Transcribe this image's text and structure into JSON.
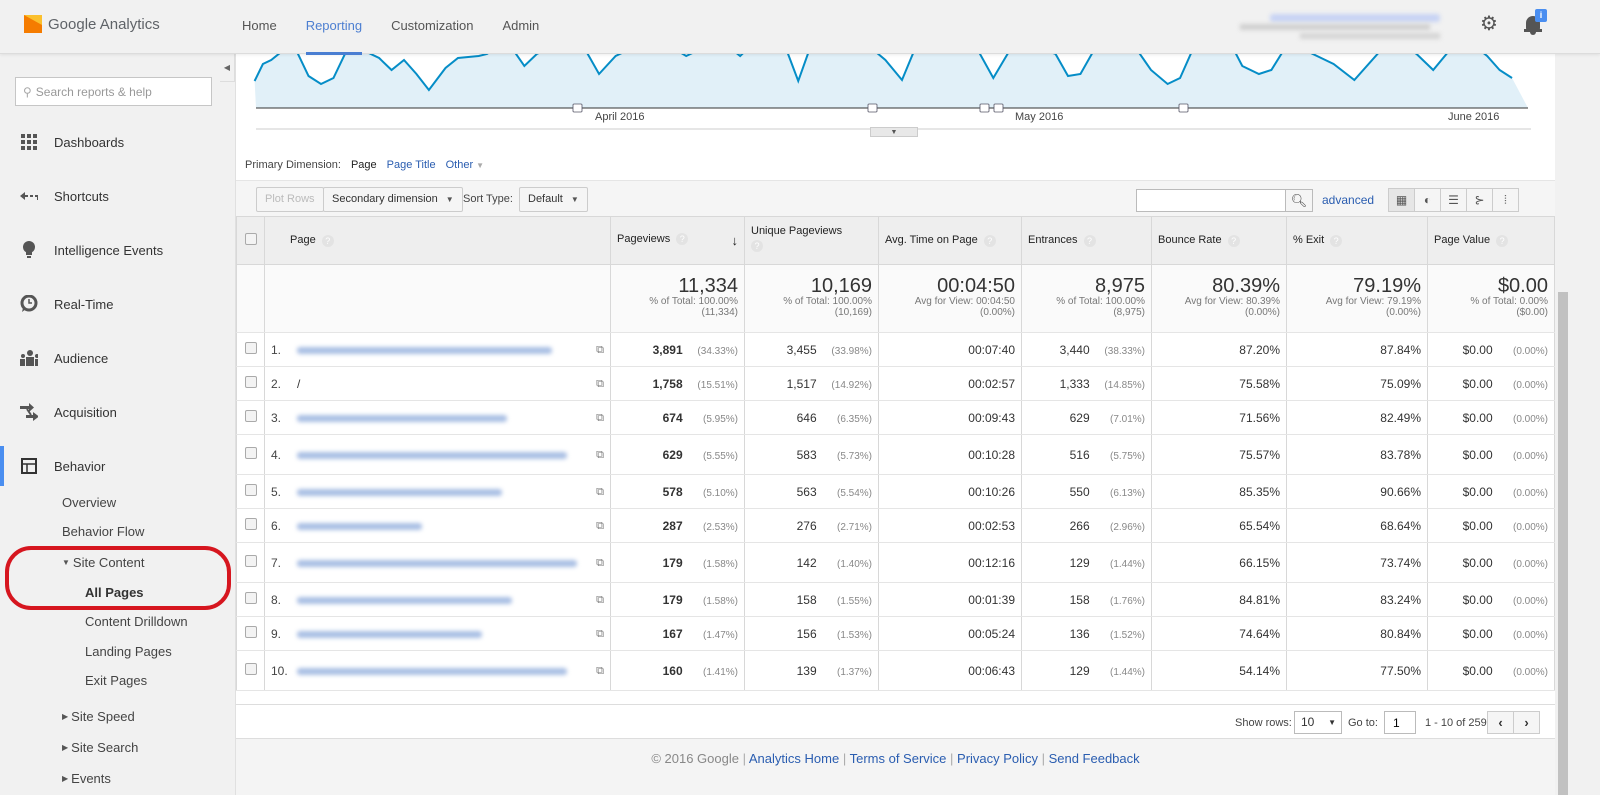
{
  "app": {
    "name_google": "Google",
    "name_product": "Analytics"
  },
  "nav": [
    {
      "label": "Home",
      "active": false
    },
    {
      "label": "Reporting",
      "active": true
    },
    {
      "label": "Customization",
      "active": false
    },
    {
      "label": "Admin",
      "active": false
    }
  ],
  "notifications": {
    "badge": "i"
  },
  "sidebar": {
    "search_placeholder": "Search reports & help",
    "items": [
      {
        "label": "Dashboards",
        "icon": "dashboards-icon"
      },
      {
        "label": "Shortcuts",
        "icon": "shortcuts-icon"
      },
      {
        "label": "Intelligence Events",
        "icon": "lightbulb-icon"
      },
      {
        "label": "Real-Time",
        "icon": "clock-icon"
      },
      {
        "label": "Audience",
        "icon": "people-icon"
      },
      {
        "label": "Acquisition",
        "icon": "arrows-icon"
      },
      {
        "label": "Behavior",
        "icon": "layout-icon"
      }
    ],
    "behavior_sub": {
      "overview": "Overview",
      "flow": "Behavior Flow",
      "site_content": "Site Content",
      "all_pages": "All Pages",
      "drilldown": "Content Drilldown",
      "landing": "Landing Pages",
      "exit": "Exit Pages",
      "speed": "Site Speed",
      "search": "Site Search",
      "events": "Events"
    }
  },
  "chart": {
    "ticks": [
      "April 2016",
      "May 2016",
      "June 2016"
    ],
    "accent": "#058dc7",
    "fill": "#e1f0f8"
  },
  "dimensions": {
    "label": "Primary Dimension:",
    "current": "Page",
    "options": [
      "Page Title",
      "Other"
    ]
  },
  "toolbar": {
    "plot_rows": "Plot Rows",
    "secondary": "Secondary dimension",
    "sort_label": "Sort Type:",
    "sort_value": "Default",
    "search_value": "",
    "advanced": "advanced"
  },
  "table": {
    "headers": [
      "Page",
      "Pageviews",
      "Unique Pageviews",
      "Avg. Time on Page",
      "Entrances",
      "Bounce Rate",
      "% Exit",
      "Page Value"
    ],
    "totals": [
      {
        "big": "11,334",
        "s1": "% of Total: 100.00%",
        "s2": "(11,334)"
      },
      {
        "big": "10,169",
        "s1": "% of Total: 100.00%",
        "s2": "(10,169)"
      },
      {
        "big": "00:04:50",
        "s1": "Avg for View: 00:04:50",
        "s2": "(0.00%)"
      },
      {
        "big": "8,975",
        "s1": "% of Total: 100.00%",
        "s2": "(8,975)"
      },
      {
        "big": "80.39%",
        "s1": "Avg for View: 80.39%",
        "s2": "(0.00%)"
      },
      {
        "big": "79.19%",
        "s1": "Avg for View: 79.19%",
        "s2": "(0.00%)"
      },
      {
        "big": "$0.00",
        "s1": "% of Total: 0.00%",
        "s2": "($0.00)"
      }
    ],
    "rows": [
      {
        "rank": "1.",
        "page": "",
        "pv": "3,891",
        "pvp": "(34.33%)",
        "upv": "3,455",
        "upvp": "(33.98%)",
        "avg": "00:07:40",
        "ent": "3,440",
        "entp": "(38.33%)",
        "br": "87.20%",
        "ex": "87.84%",
        "val": "$0.00",
        "valp": "(0.00%)"
      },
      {
        "rank": "2.",
        "page": "/",
        "pv": "1,758",
        "pvp": "(15.51%)",
        "upv": "1,517",
        "upvp": "(14.92%)",
        "avg": "00:02:57",
        "ent": "1,333",
        "entp": "(14.85%)",
        "br": "75.58%",
        "ex": "75.09%",
        "val": "$0.00",
        "valp": "(0.00%)"
      },
      {
        "rank": "3.",
        "page": "",
        "pv": "674",
        "pvp": "(5.95%)",
        "upv": "646",
        "upvp": "(6.35%)",
        "avg": "00:09:43",
        "ent": "629",
        "entp": "(7.01%)",
        "br": "71.56%",
        "ex": "82.49%",
        "val": "$0.00",
        "valp": "(0.00%)"
      },
      {
        "rank": "4.",
        "page": "",
        "pv": "629",
        "pvp": "(5.55%)",
        "upv": "583",
        "upvp": "(5.73%)",
        "avg": "00:10:28",
        "ent": "516",
        "entp": "(5.75%)",
        "br": "75.57%",
        "ex": "83.78%",
        "val": "$0.00",
        "valp": "(0.00%)"
      },
      {
        "rank": "5.",
        "page": "",
        "pv": "578",
        "pvp": "(5.10%)",
        "upv": "563",
        "upvp": "(5.54%)",
        "avg": "00:10:26",
        "ent": "550",
        "entp": "(6.13%)",
        "br": "85.35%",
        "ex": "90.66%",
        "val": "$0.00",
        "valp": "(0.00%)"
      },
      {
        "rank": "6.",
        "page": "",
        "pv": "287",
        "pvp": "(2.53%)",
        "upv": "276",
        "upvp": "(2.71%)",
        "avg": "00:02:53",
        "ent": "266",
        "entp": "(2.96%)",
        "br": "65.54%",
        "ex": "68.64%",
        "val": "$0.00",
        "valp": "(0.00%)"
      },
      {
        "rank": "7.",
        "page": "",
        "pv": "179",
        "pvp": "(1.58%)",
        "upv": "142",
        "upvp": "(1.40%)",
        "avg": "00:12:16",
        "ent": "129",
        "entp": "(1.44%)",
        "br": "66.15%",
        "ex": "73.74%",
        "val": "$0.00",
        "valp": "(0.00%)"
      },
      {
        "rank": "8.",
        "page": "",
        "pv": "179",
        "pvp": "(1.58%)",
        "upv": "158",
        "upvp": "(1.55%)",
        "avg": "00:01:39",
        "ent": "158",
        "entp": "(1.76%)",
        "br": "84.81%",
        "ex": "83.24%",
        "val": "$0.00",
        "valp": "(0.00%)"
      },
      {
        "rank": "9.",
        "page": "",
        "pv": "167",
        "pvp": "(1.47%)",
        "upv": "156",
        "upvp": "(1.53%)",
        "avg": "00:05:24",
        "ent": "136",
        "entp": "(1.52%)",
        "br": "74.64%",
        "ex": "80.84%",
        "val": "$0.00",
        "valp": "(0.00%)"
      },
      {
        "rank": "10.",
        "page": "",
        "pv": "160",
        "pvp": "(1.41%)",
        "upv": "139",
        "upvp": "(1.37%)",
        "avg": "00:06:43",
        "ent": "129",
        "entp": "(1.44%)",
        "br": "54.14%",
        "ex": "77.50%",
        "val": "$0.00",
        "valp": "(0.00%)"
      }
    ]
  },
  "pager": {
    "show_rows_label": "Show rows:",
    "show_rows": "10",
    "goto_label": "Go to:",
    "goto_value": "1",
    "range": "1 - 10 of 259"
  },
  "footer": {
    "copyright": "© 2016 Google",
    "links": [
      "Analytics Home",
      "Terms of Service",
      "Privacy Policy",
      "Send Feedback"
    ]
  }
}
